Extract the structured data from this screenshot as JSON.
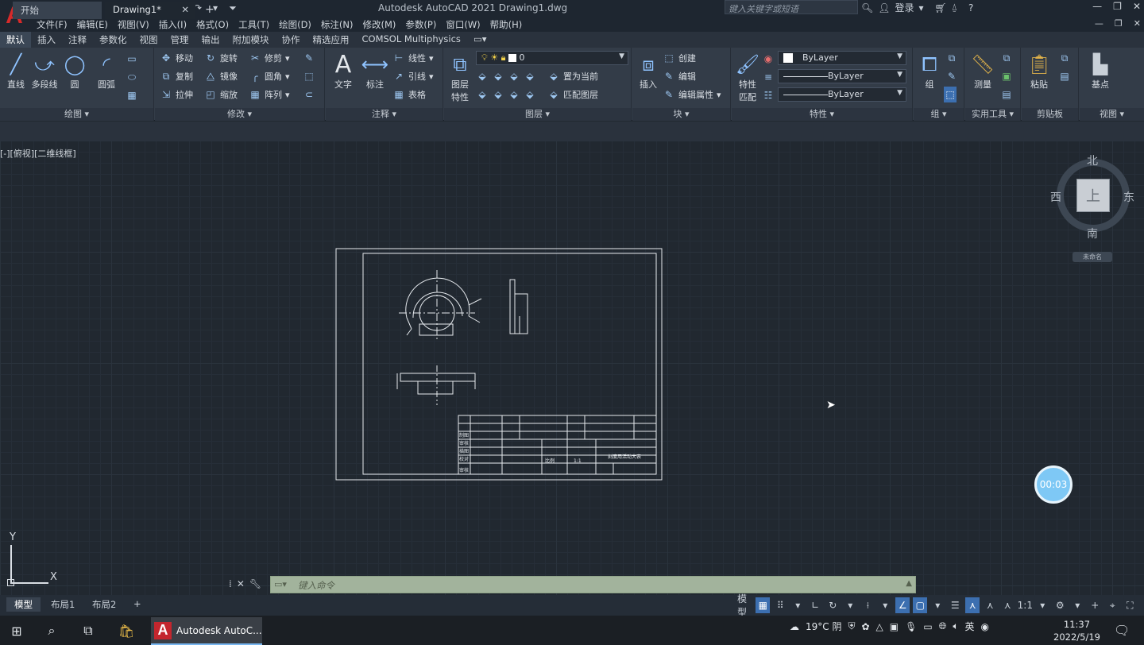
{
  "titlebar": {
    "app_title": "Autodesk AutoCAD 2021    Drawing1.dwg",
    "search_placeholder": "键入关键字或短语",
    "login": "登录",
    "logo_letter": "A"
  },
  "menu": [
    "文件(F)",
    "编辑(E)",
    "视图(V)",
    "插入(I)",
    "格式(O)",
    "工具(T)",
    "绘图(D)",
    "标注(N)",
    "修改(M)",
    "参数(P)",
    "窗口(W)",
    "帮助(H)"
  ],
  "ribbon_tabs": [
    "默认",
    "插入",
    "注释",
    "参数化",
    "视图",
    "管理",
    "输出",
    "附加模块",
    "协作",
    "精选应用",
    "COMSOL Multiphysics"
  ],
  "ribbon": {
    "draw": {
      "title": "绘图",
      "line": "直线",
      "polyline": "多段线",
      "circle": "圆",
      "arc": "圆弧"
    },
    "modify": {
      "title": "修改",
      "move": "移动",
      "rotate": "旋转",
      "trim": "修剪",
      "copy": "复制",
      "mirror": "镜像",
      "fillet": "圆角",
      "stretch": "拉伸",
      "scale": "缩放",
      "array": "阵列"
    },
    "annotation": {
      "title": "注释",
      "text": "文字",
      "dimension": "标注",
      "linear": "线性",
      "leader": "引线",
      "table": "表格"
    },
    "layers": {
      "title": "图层",
      "layer_props_1": "图层",
      "layer_props_2": "特性",
      "current_layer": "0",
      "make_current": "置为当前",
      "match_layer": "匹配图层"
    },
    "block": {
      "title": "块",
      "insert": "插入",
      "create": "创建",
      "edit": "编辑",
      "edit_attr": "编辑属性"
    },
    "properties": {
      "title": "特性",
      "match_1": "特性",
      "match_2": "匹配",
      "color": "ByLayer",
      "linetype": "ByLayer",
      "lineweight": "ByLayer"
    },
    "groups": {
      "title": "组",
      "group": "组"
    },
    "utilities": {
      "title": "实用工具",
      "measure": "测量"
    },
    "clipboard": {
      "title": "剪贴板",
      "paste": "粘贴"
    },
    "view": {
      "title": "视图",
      "base": "基点"
    }
  },
  "file_tabs": {
    "start": "开始",
    "drawing": "Drawing1*"
  },
  "viewport_label": "[-][俯视][二维线框]",
  "viewcube": {
    "north": "北",
    "south": "南",
    "east": "东",
    "west": "西",
    "face": "上",
    "wcs": "未命名"
  },
  "timer": "00:03",
  "ucs": {
    "x": "X",
    "y": "Y"
  },
  "command_placeholder": "键入命令",
  "layout_tabs": [
    "模型",
    "布局1",
    "布局2"
  ],
  "status": {
    "model": "模型",
    "scale": "1:1"
  },
  "title_block": {
    "rows": [
      "制图",
      "审核",
      "描图",
      "校对",
      "审核"
    ],
    "scale_label": "比例",
    "scale_value": "1:1",
    "part_name": "刻度用活动大表"
  },
  "taskbar": {
    "app": "Autodesk AutoC...",
    "weather": "19°C 阴",
    "ime": "英",
    "time": "11:37",
    "date": "2022/5/19"
  }
}
